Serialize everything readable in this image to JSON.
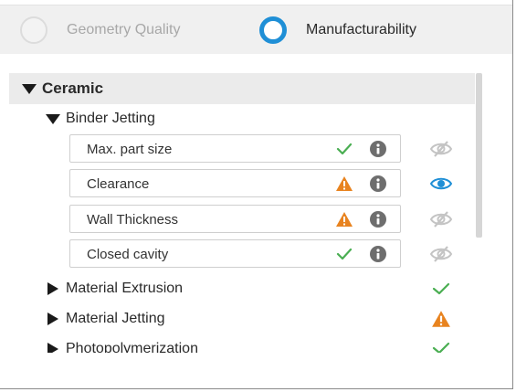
{
  "tabs": [
    {
      "label": "Geometry Quality",
      "selected": false
    },
    {
      "label": "Manufacturability",
      "selected": true
    }
  ],
  "colors": {
    "accent": "#1f8fd6",
    "ok": "#4aae52",
    "warning": "#e8831f",
    "info": "#6e6e6e",
    "muted": "#bdbdbd"
  },
  "tree": {
    "category": {
      "label": "Ceramic",
      "expanded": true
    },
    "expanded_process": {
      "label": "Binder Jetting",
      "checks": [
        {
          "label": "Max. part size",
          "status": "check-icon",
          "visibility": "eye-slash-icon"
        },
        {
          "label": "Clearance",
          "status": "warning-icon",
          "visibility": "eye-icon"
        },
        {
          "label": "Wall Thickness",
          "status": "warning-icon",
          "visibility": "eye-slash-icon"
        },
        {
          "label": "Closed cavity",
          "status": "check-icon",
          "visibility": "eye-slash-icon"
        }
      ]
    },
    "collapsed_processes": [
      {
        "label": "Material Extrusion",
        "status": "check-icon"
      },
      {
        "label": "Material Jetting",
        "status": "warning-icon"
      },
      {
        "label": "Photopolymerization",
        "status": "check-icon"
      }
    ]
  }
}
